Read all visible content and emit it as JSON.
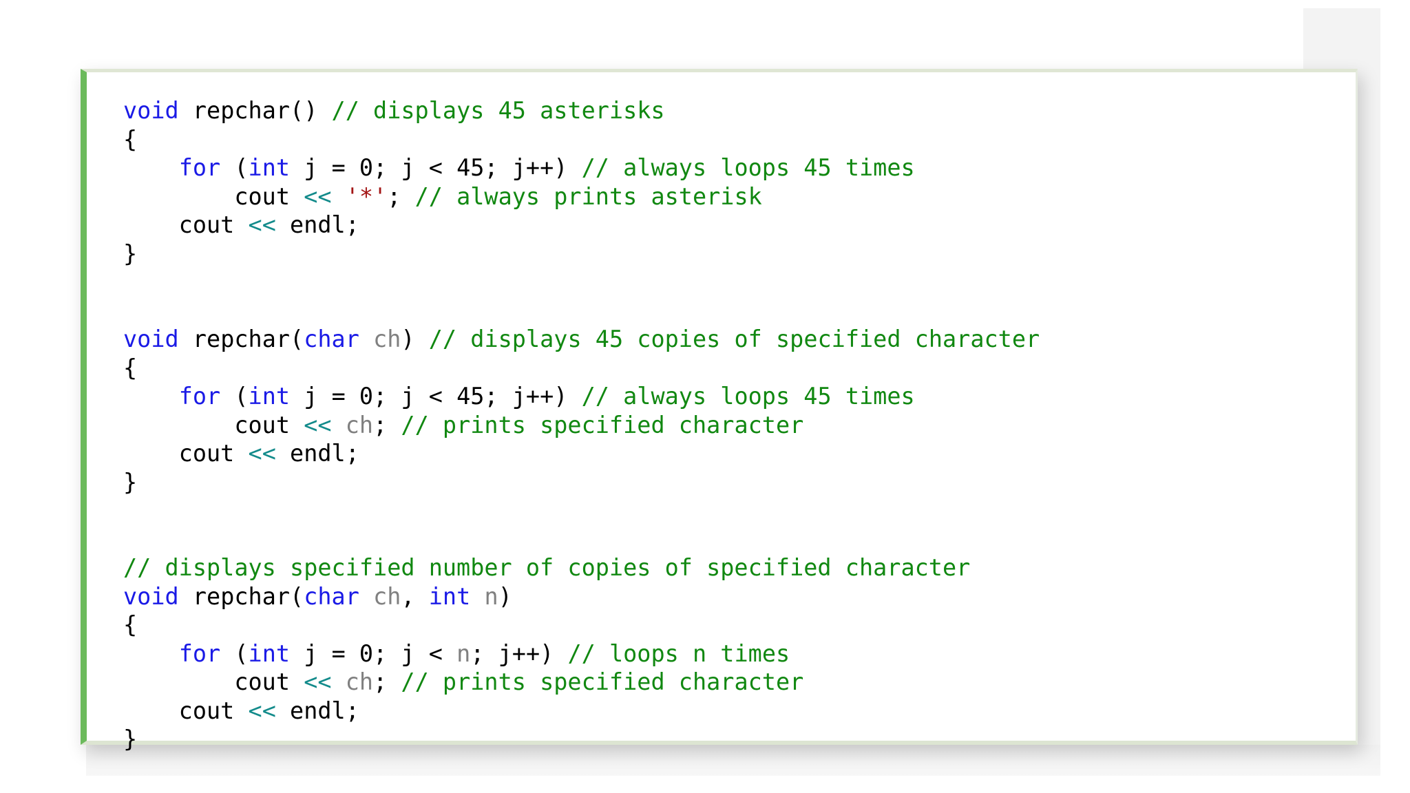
{
  "code": {
    "lines": [
      [
        {
          "t": "kw",
          "v": "void"
        },
        {
          "t": "tx",
          "v": " repchar() "
        },
        {
          "t": "cm",
          "v": "// displays 45 asterisks"
        }
      ],
      [
        {
          "t": "tx",
          "v": "{"
        }
      ],
      [
        {
          "t": "tx",
          "v": "    "
        },
        {
          "t": "kw",
          "v": "for"
        },
        {
          "t": "tx",
          "v": " ("
        },
        {
          "t": "kw",
          "v": "int"
        },
        {
          "t": "tx",
          "v": " j = 0; j < 45; j++) "
        },
        {
          "t": "cm",
          "v": "// always loops 45 times"
        }
      ],
      [
        {
          "t": "tx",
          "v": "        cout "
        },
        {
          "t": "op",
          "v": "<<"
        },
        {
          "t": "tx",
          "v": " "
        },
        {
          "t": "st",
          "v": "'*'"
        },
        {
          "t": "tx",
          "v": "; "
        },
        {
          "t": "cm",
          "v": "// always prints asterisk"
        }
      ],
      [
        {
          "t": "tx",
          "v": "    cout "
        },
        {
          "t": "op",
          "v": "<<"
        },
        {
          "t": "tx",
          "v": " endl;"
        }
      ],
      [
        {
          "t": "tx",
          "v": "}"
        }
      ],
      [],
      [],
      [
        {
          "t": "kw",
          "v": "void"
        },
        {
          "t": "tx",
          "v": " repchar("
        },
        {
          "t": "kw",
          "v": "char"
        },
        {
          "t": "tx",
          "v": " "
        },
        {
          "t": "pm",
          "v": "ch"
        },
        {
          "t": "tx",
          "v": ") "
        },
        {
          "t": "cm",
          "v": "// displays 45 copies of specified character"
        }
      ],
      [
        {
          "t": "tx",
          "v": "{"
        }
      ],
      [
        {
          "t": "tx",
          "v": "    "
        },
        {
          "t": "kw",
          "v": "for"
        },
        {
          "t": "tx",
          "v": " ("
        },
        {
          "t": "kw",
          "v": "int"
        },
        {
          "t": "tx",
          "v": " j = 0; j < 45; j++) "
        },
        {
          "t": "cm",
          "v": "// always loops 45 times"
        }
      ],
      [
        {
          "t": "tx",
          "v": "        cout "
        },
        {
          "t": "op",
          "v": "<<"
        },
        {
          "t": "tx",
          "v": " "
        },
        {
          "t": "pm",
          "v": "ch"
        },
        {
          "t": "tx",
          "v": "; "
        },
        {
          "t": "cm",
          "v": "// prints specified character"
        }
      ],
      [
        {
          "t": "tx",
          "v": "    cout "
        },
        {
          "t": "op",
          "v": "<<"
        },
        {
          "t": "tx",
          "v": " endl;"
        }
      ],
      [
        {
          "t": "tx",
          "v": "}"
        }
      ],
      [],
      [],
      [
        {
          "t": "cm",
          "v": "// displays specified number of copies of specified character"
        }
      ],
      [
        {
          "t": "kw",
          "v": "void"
        },
        {
          "t": "tx",
          "v": " repchar("
        },
        {
          "t": "kw",
          "v": "char"
        },
        {
          "t": "tx",
          "v": " "
        },
        {
          "t": "pm",
          "v": "ch"
        },
        {
          "t": "tx",
          "v": ", "
        },
        {
          "t": "kw",
          "v": "int"
        },
        {
          "t": "tx",
          "v": " "
        },
        {
          "t": "pm",
          "v": "n"
        },
        {
          "t": "tx",
          "v": ")"
        }
      ],
      [
        {
          "t": "tx",
          "v": "{"
        }
      ],
      [
        {
          "t": "tx",
          "v": "    "
        },
        {
          "t": "kw",
          "v": "for"
        },
        {
          "t": "tx",
          "v": " ("
        },
        {
          "t": "kw",
          "v": "int"
        },
        {
          "t": "tx",
          "v": " j = 0; j < "
        },
        {
          "t": "pm",
          "v": "n"
        },
        {
          "t": "tx",
          "v": "; j++) "
        },
        {
          "t": "cm",
          "v": "// loops n times"
        }
      ],
      [
        {
          "t": "tx",
          "v": "        cout "
        },
        {
          "t": "op",
          "v": "<<"
        },
        {
          "t": "tx",
          "v": " "
        },
        {
          "t": "pm",
          "v": "ch"
        },
        {
          "t": "tx",
          "v": "; "
        },
        {
          "t": "cm",
          "v": "// prints specified character"
        }
      ],
      [
        {
          "t": "tx",
          "v": "    cout "
        },
        {
          "t": "op",
          "v": "<<"
        },
        {
          "t": "tx",
          "v": " endl;"
        }
      ],
      [
        {
          "t": "tx",
          "v": "}"
        }
      ]
    ]
  }
}
